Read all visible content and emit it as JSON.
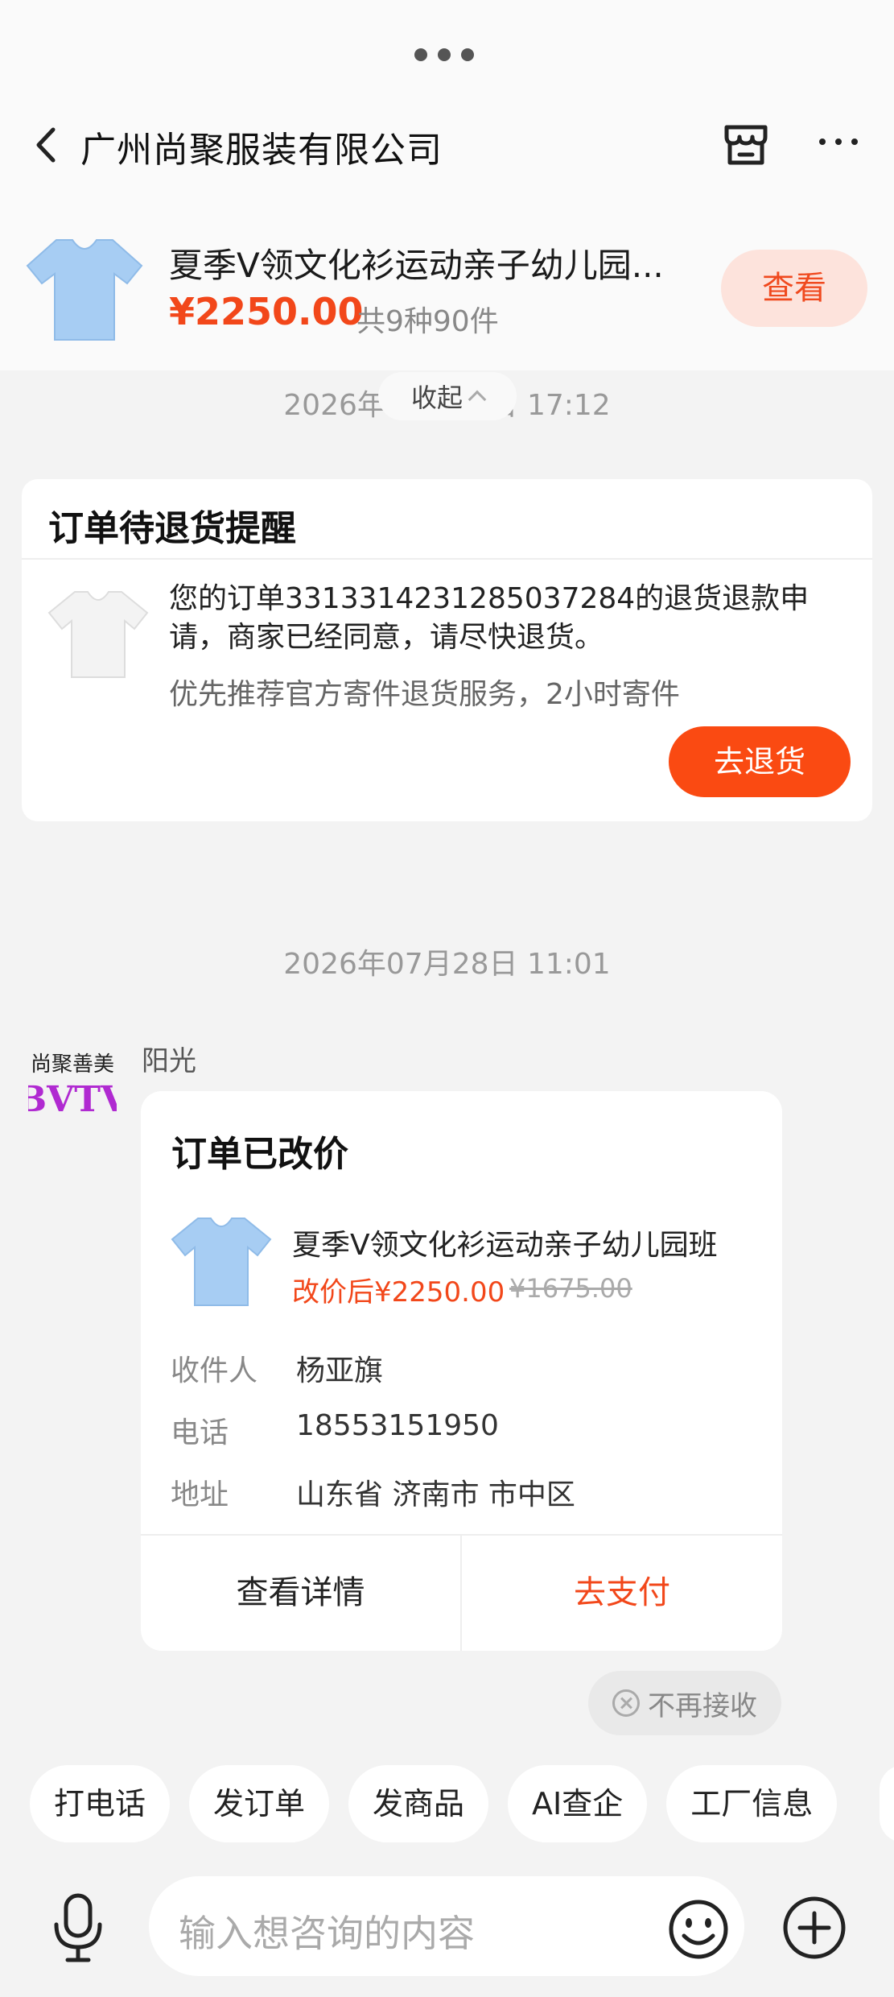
{
  "header": {
    "title": "广州尚聚服装有限公司"
  },
  "product_bar": {
    "title": "夏季V领文化衫运动亲子幼儿园...",
    "price": "¥2250.00",
    "count": "共9种90件",
    "view_label": "查看"
  },
  "timeline": {
    "time1": "2026年07月28日 17:12",
    "collapse_label": "收起",
    "time2": "2026年07月28日 11:01"
  },
  "return_card": {
    "title": "订单待退货提醒",
    "message": "您的订单3313314231285037284的退货退款申请，商家已经同意，请尽快退货。",
    "sub": "优先推荐官方寄件退货服务，2小时寄件",
    "button_label": "去退货"
  },
  "sender": {
    "name": "阳光",
    "avatar_text_top": "尚聚善美",
    "avatar_text_bottom": "BVTV"
  },
  "order_card": {
    "title": "订单已改价",
    "product_title": "夏季V领文化衫运动亲子幼儿园班",
    "new_price": "改价后¥2250.00",
    "old_price": "¥1675.00",
    "fields": [
      {
        "label": "收件人",
        "value": "杨亚旗"
      },
      {
        "label": "电话",
        "value": "18553151950"
      },
      {
        "label": "地址",
        "value": "山东省 济南市 市中区"
      }
    ],
    "detail_label": "查看详情",
    "pay_label": "去支付"
  },
  "no_receive_label": "不再接收",
  "chips": [
    "打电话",
    "发订单",
    "发商品",
    "AI查企",
    "工厂信息"
  ],
  "input": {
    "placeholder": "输入想咨询的内容"
  },
  "colors": {
    "accent": "#f2471a",
    "accent_bg": "#fde3dc",
    "return_button": "#fa4a12",
    "background": "#f3f3f3"
  },
  "icons": [
    "more-dots-icon",
    "back-arrow-icon",
    "shop-icon",
    "more-icon",
    "close-circle-icon",
    "mic-icon",
    "emoji-icon",
    "plus-icon"
  ]
}
